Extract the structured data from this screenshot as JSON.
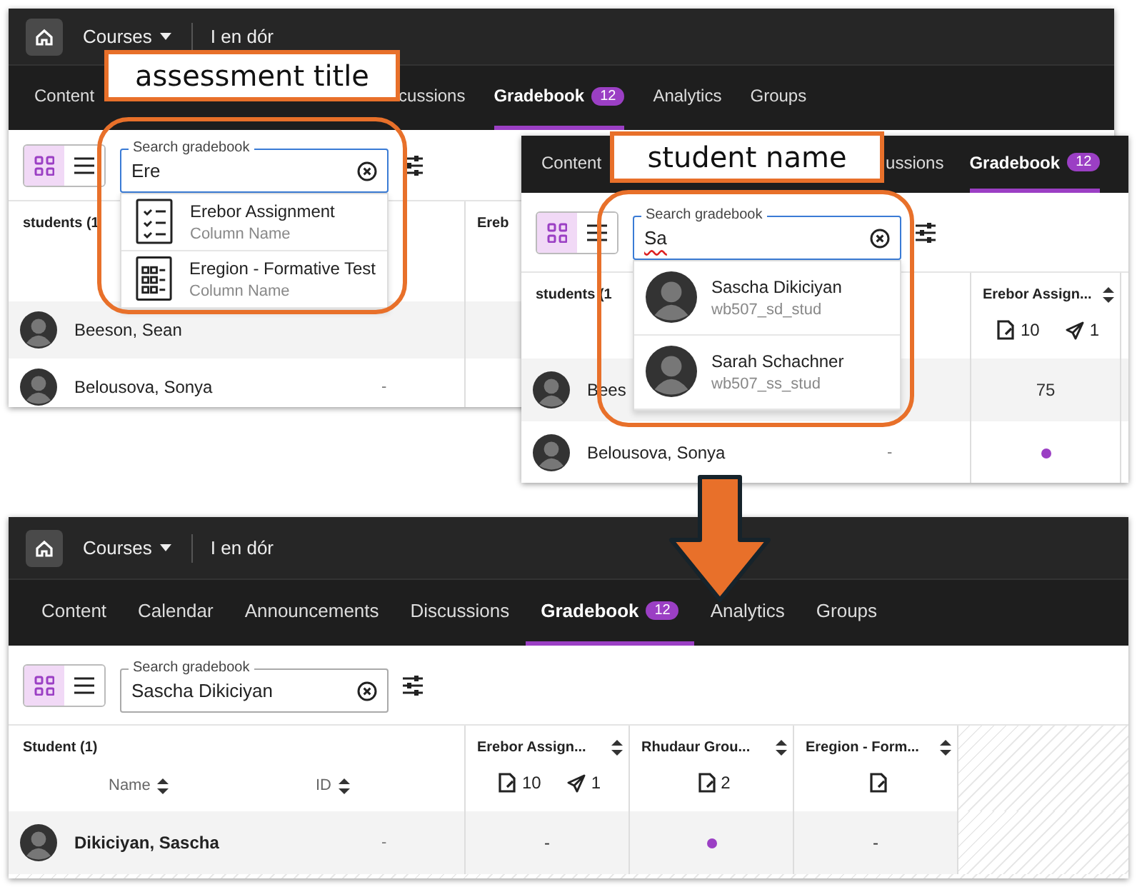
{
  "panels": [
    {
      "course_bar": {
        "courses_menu": "Courses",
        "course_title": "I en dór"
      },
      "tabs": [
        {
          "label": "Content",
          "selected": false
        },
        {
          "label": "cussions",
          "selected": false
        },
        {
          "label": "Gradebook",
          "badge": "12",
          "selected": true
        },
        {
          "label": "Analytics",
          "selected": false
        },
        {
          "label": "Groups",
          "selected": false
        }
      ],
      "callout": {
        "text": "assessment title"
      },
      "view_modes": [
        {
          "kind": "grid",
          "selected": true
        },
        {
          "kind": "list",
          "selected": false
        }
      ],
      "search": {
        "label": "Search gradebook",
        "value": "Ere",
        "focused": true,
        "spell_error": false
      },
      "suggestions": [
        {
          "kind": "assignment",
          "title": "Erebor Assignment",
          "subtitle": "Column Name"
        },
        {
          "kind": "test",
          "title": "Eregion - Formative Test",
          "subtitle": "Column Name"
        }
      ],
      "table": {
        "student_header": "students (1",
        "columns": [
          {
            "title": "Ereb"
          }
        ],
        "rows": [
          {
            "name": "Beeson, Sean",
            "bold": false,
            "cells": []
          },
          {
            "name": "Belousova, Sonya",
            "id": "-",
            "bold": false,
            "cells": []
          }
        ]
      }
    },
    {
      "tabs": [
        {
          "label": "Content",
          "selected": false
        },
        {
          "label": "ussions",
          "selected": false
        },
        {
          "label": "Gradebook",
          "badge": "12",
          "selected": true
        }
      ],
      "callout": {
        "text": "student name"
      },
      "view_modes": [
        {
          "kind": "grid",
          "selected": true
        },
        {
          "kind": "list",
          "selected": false
        }
      ],
      "search": {
        "label": "Search gradebook",
        "value": "Sa",
        "focused": true,
        "spell_error": true
      },
      "suggestions": [
        {
          "kind": "student",
          "title": "Sascha Dikiciyan",
          "subtitle": "wb507_sd_stud"
        },
        {
          "kind": "student",
          "title": "Sarah Schachner",
          "subtitle": "wb507_ss_stud"
        }
      ],
      "table": {
        "student_header": "students (1",
        "columns": [
          {
            "title": "Erebor Assign...",
            "sortable": true,
            "counts": [
              {
                "kind": "submissions",
                "text": "10"
              },
              {
                "kind": "sent",
                "text": "1"
              }
            ]
          }
        ],
        "rows": [
          {
            "name": "Bees",
            "bold": false,
            "cells": [
              {
                "kind": "text",
                "text": "75"
              }
            ]
          },
          {
            "name": "Belousova, Sonya",
            "id": "-",
            "bold": false,
            "cells": [
              {
                "kind": "dot"
              }
            ]
          }
        ]
      }
    },
    {
      "course_bar": {
        "courses_menu": "Courses",
        "course_title": "I en dór"
      },
      "tabs": [
        {
          "label": "Content",
          "selected": false
        },
        {
          "label": "Calendar",
          "selected": false
        },
        {
          "label": "Announcements",
          "selected": false
        },
        {
          "label": "Discussions",
          "selected": false
        },
        {
          "label": "Gradebook",
          "badge": "12",
          "selected": true
        },
        {
          "label": "Analytics",
          "selected": false
        },
        {
          "label": "Groups",
          "selected": false
        }
      ],
      "view_modes": [
        {
          "kind": "grid",
          "selected": true
        },
        {
          "kind": "list",
          "selected": false
        }
      ],
      "search": {
        "label": "Search gradebook",
        "value": "Sascha Dikiciyan",
        "focused": false,
        "spell_error": false
      },
      "table": {
        "student_header": "Student (1)",
        "name_header": "Name",
        "id_header": "ID",
        "columns": [
          {
            "title": "Erebor Assign...",
            "sortable": true,
            "counts": [
              {
                "kind": "submissions",
                "text": "10"
              },
              {
                "kind": "sent",
                "text": "1"
              }
            ]
          },
          {
            "title": "Rhudaur Grou...",
            "sortable": true,
            "counts": [
              {
                "kind": "submissions",
                "text": "2"
              }
            ]
          },
          {
            "title": "Eregion - Form...",
            "sortable": true,
            "counts": [
              {
                "kind": "submissions"
              }
            ]
          }
        ],
        "rows": [
          {
            "name": "Dikiciyan, Sascha",
            "id": "-",
            "bold": true,
            "cells": [
              {
                "kind": "text",
                "text": "-"
              },
              {
                "kind": "dot"
              },
              {
                "kind": "text",
                "text": "-"
              }
            ]
          }
        ]
      }
    }
  ]
}
